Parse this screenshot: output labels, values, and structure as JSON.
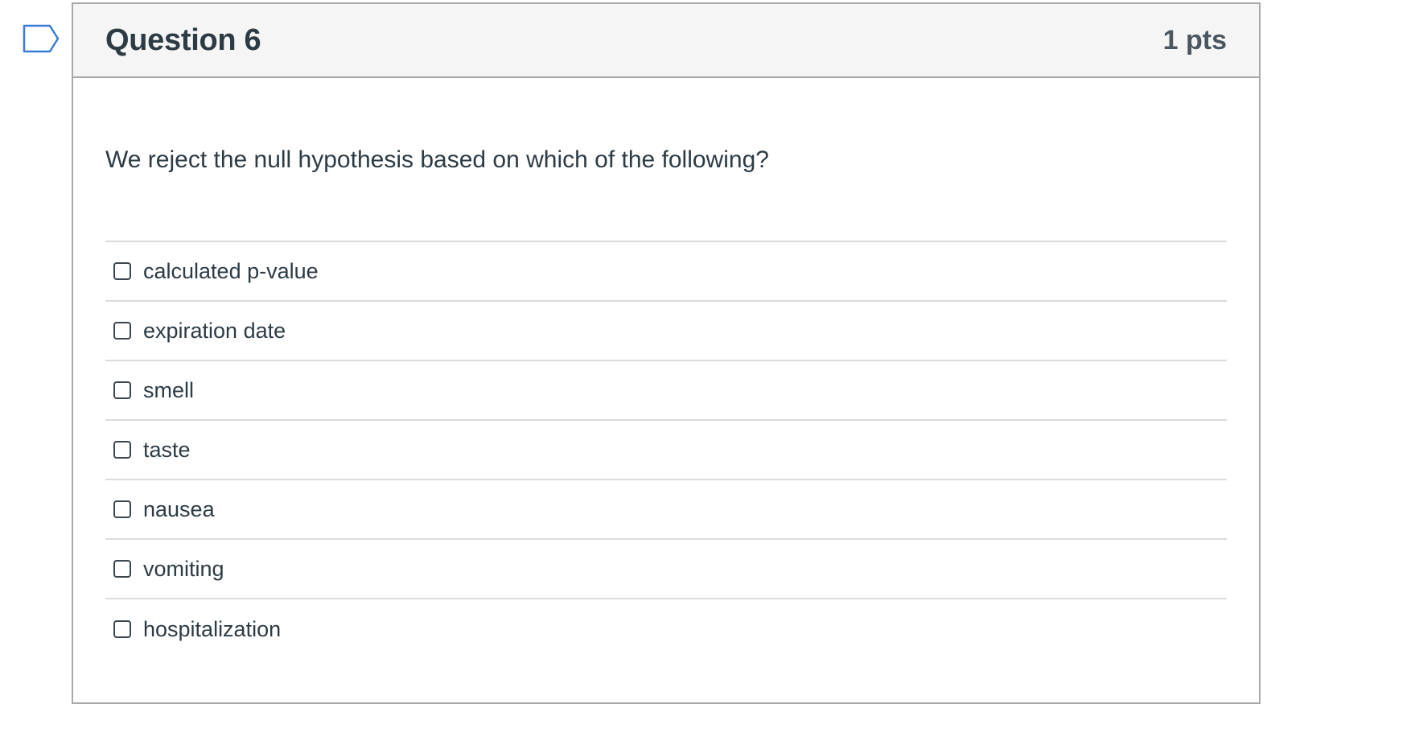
{
  "question": {
    "title": "Question 6",
    "points": "1 pts",
    "text": "We reject the null hypothesis based on which of the following?",
    "flag_icon": "flag-question-icon",
    "answers": [
      {
        "label": "calculated p-value",
        "checked": false
      },
      {
        "label": "expiration date",
        "checked": false
      },
      {
        "label": "smell",
        "checked": false
      },
      {
        "label": "taste",
        "checked": false
      },
      {
        "label": "nausea",
        "checked": false
      },
      {
        "label": "vomiting",
        "checked": false
      },
      {
        "label": "hospitalization",
        "checked": false
      }
    ]
  },
  "colors": {
    "header_bg": "#f5f5f5",
    "border": "#a8a8a8",
    "divider": "#dcdcdc",
    "text": "#2d3b45",
    "flag_outline": "#3a7bd5"
  }
}
